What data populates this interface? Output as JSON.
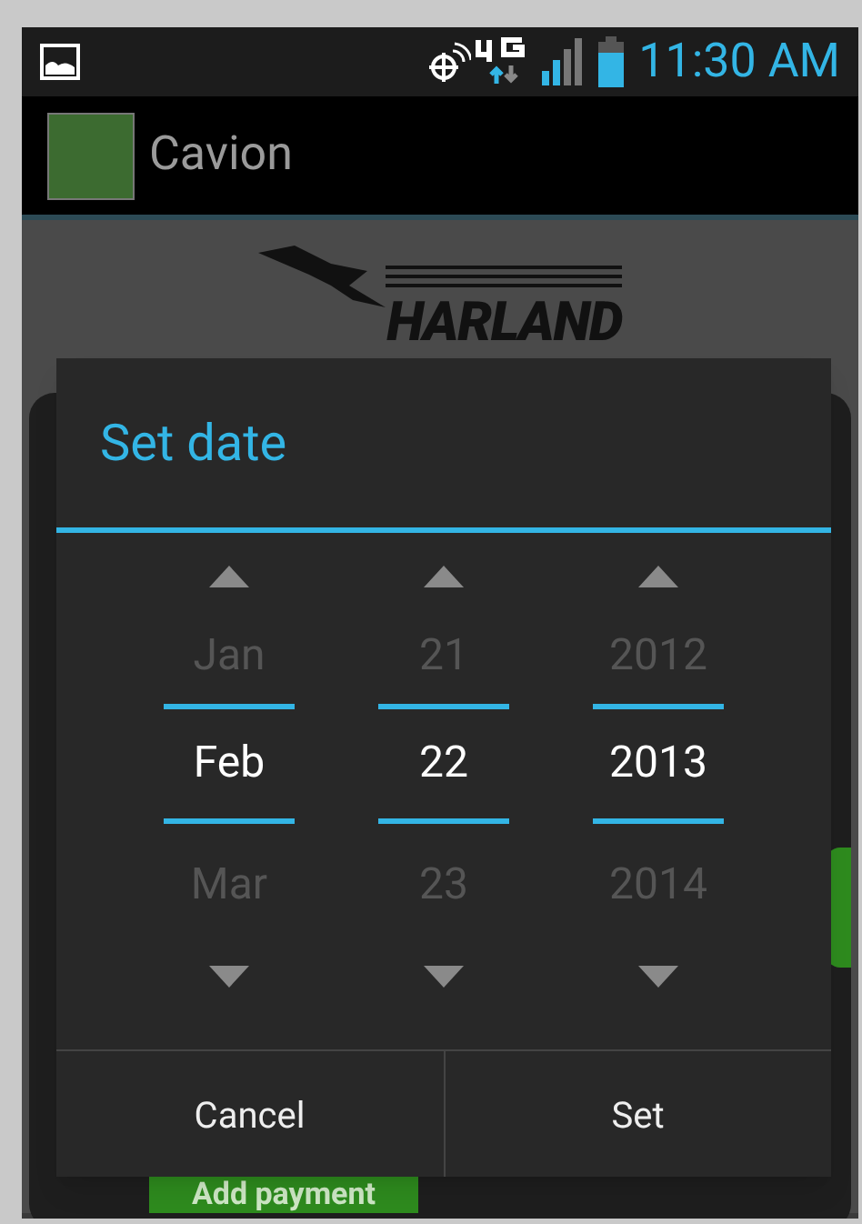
{
  "status_bar": {
    "time": "11:30 AM"
  },
  "app_bar": {
    "title": "Cavion"
  },
  "logo": {
    "text": "HARLAND"
  },
  "background": {
    "button": "Add payment"
  },
  "dialog": {
    "title": "Set date",
    "pickers": [
      {
        "previous": "Jan",
        "current": "Feb",
        "next": "Mar"
      },
      {
        "previous": "21",
        "current": "22",
        "next": "23"
      },
      {
        "previous": "2012",
        "current": "2013",
        "next": "2014"
      }
    ],
    "buttons": [
      "Cancel",
      "Set"
    ]
  }
}
